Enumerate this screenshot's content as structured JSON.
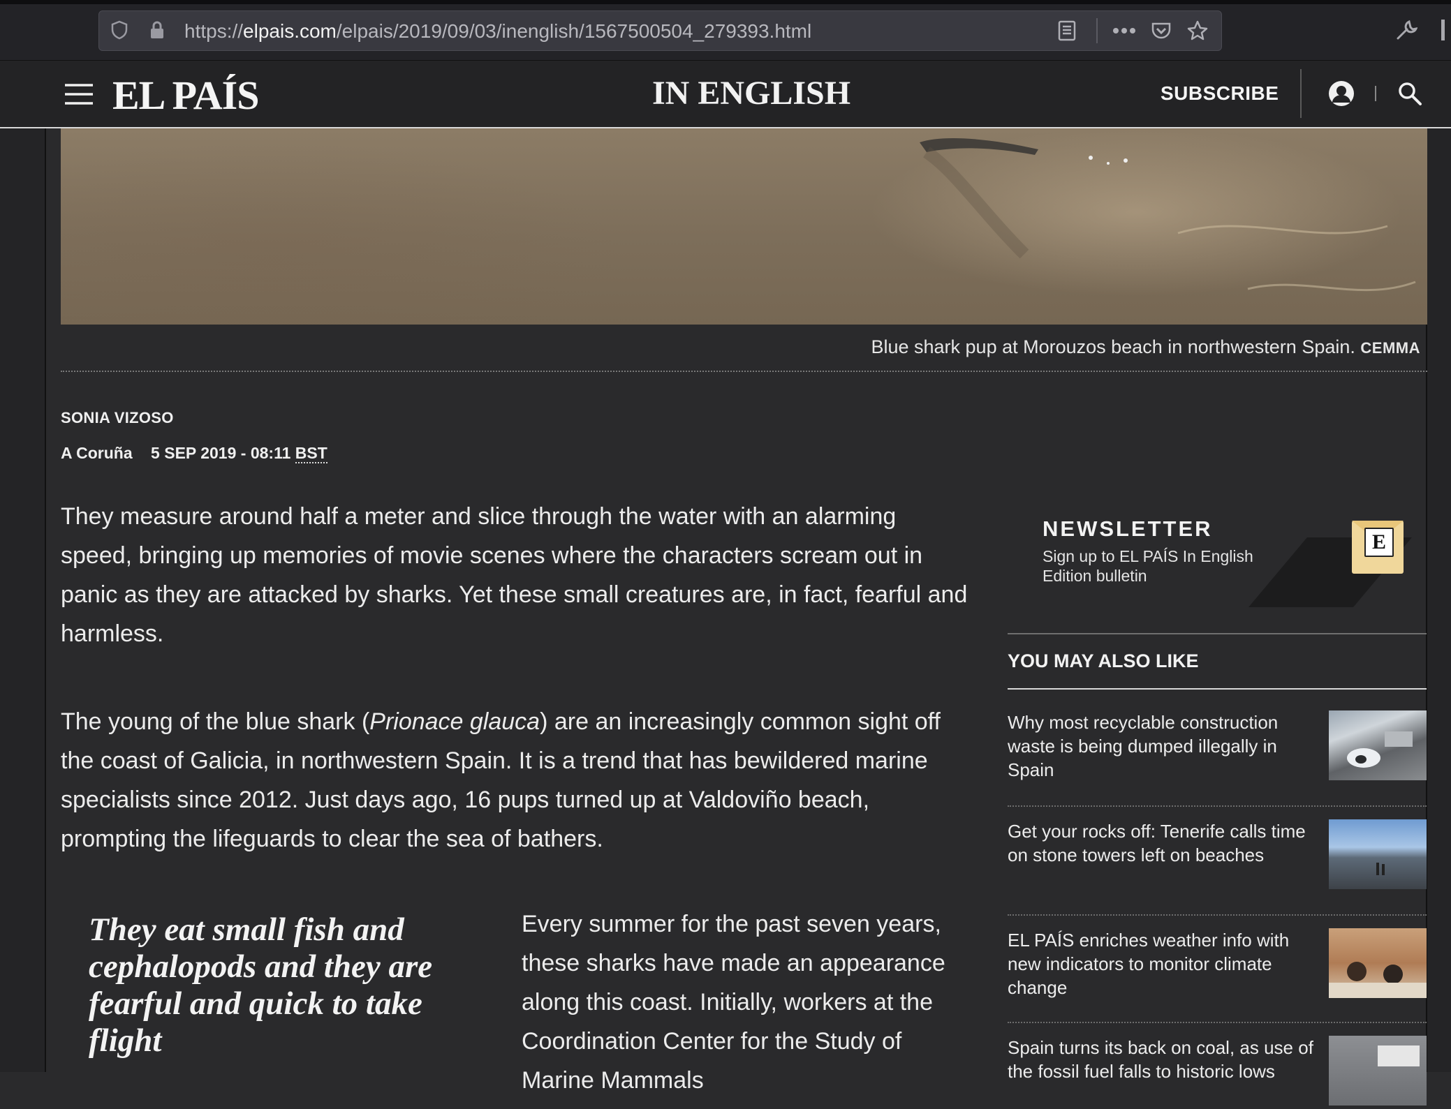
{
  "browser": {
    "url_prefix": "https://",
    "url_host": "elpais.com",
    "url_path": "/elpais/2019/09/03/inenglish/1567500504_279393.html",
    "icons": [
      "shield-icon",
      "lock-icon",
      "reader-view-icon",
      "more-icon",
      "pocket-icon",
      "bookmark-star-icon",
      "wrench-icon"
    ]
  },
  "header": {
    "logo": "EL PAÍS",
    "section": "IN ENGLISH",
    "subscribe": "SUBSCRIBE",
    "icons": [
      "menu-icon",
      "account-icon",
      "search-icon"
    ]
  },
  "article": {
    "caption_text": "Blue shark pup at Morouzos beach in northwestern Spain.",
    "caption_credit": "CEMMA",
    "author": "SONIA VIZOSO",
    "city": "A Coruña",
    "date": "5 SEP 2019 - 08:11",
    "timezone": "BST",
    "para1": "They measure around half a meter and slice through the water with an alarming speed, bringing up memories of movie scenes where the characters scream out in panic as they are attacked by sharks. Yet these small creatures are, in fact, fearful and harmless.",
    "para2_before": "The young of the blue shark (",
    "para2_species": "Prionace glauca",
    "para2_after": ") are an increasingly common sight off the coast of Galicia, in northwestern Spain. It is a trend that has bewildered marine specialists since 2012. Just days ago, 16 pups turned up at Valdoviño beach, prompting the lifeguards to clear the sea of bathers.",
    "pull_quote": "They eat small fish and cephalopods and they are fearful and quick to take flight",
    "para3": "Every summer for the past seven years, these sharks have made an appearance along this coast. Initially, workers at the Coordination Center for the Study of Marine Mammals"
  },
  "sidebar": {
    "newsletter_title": "NEWSLETTER",
    "newsletter_text": "Sign up to EL PAÍS In English Edition bulletin",
    "newsletter_icon_letter": "E",
    "related_heading": "YOU MAY ALSO LIKE",
    "related": [
      {
        "title": "Why most recyclable construction waste is being dumped illegally in Spain"
      },
      {
        "title": "Get your rocks off: Tenerife calls time on stone towers left on beaches"
      },
      {
        "title": "EL PAÍS enriches weather info with new indicators to monitor climate change"
      },
      {
        "title": "Spain turns its back on coal, as use of the fossil fuel falls to historic lows"
      }
    ]
  }
}
